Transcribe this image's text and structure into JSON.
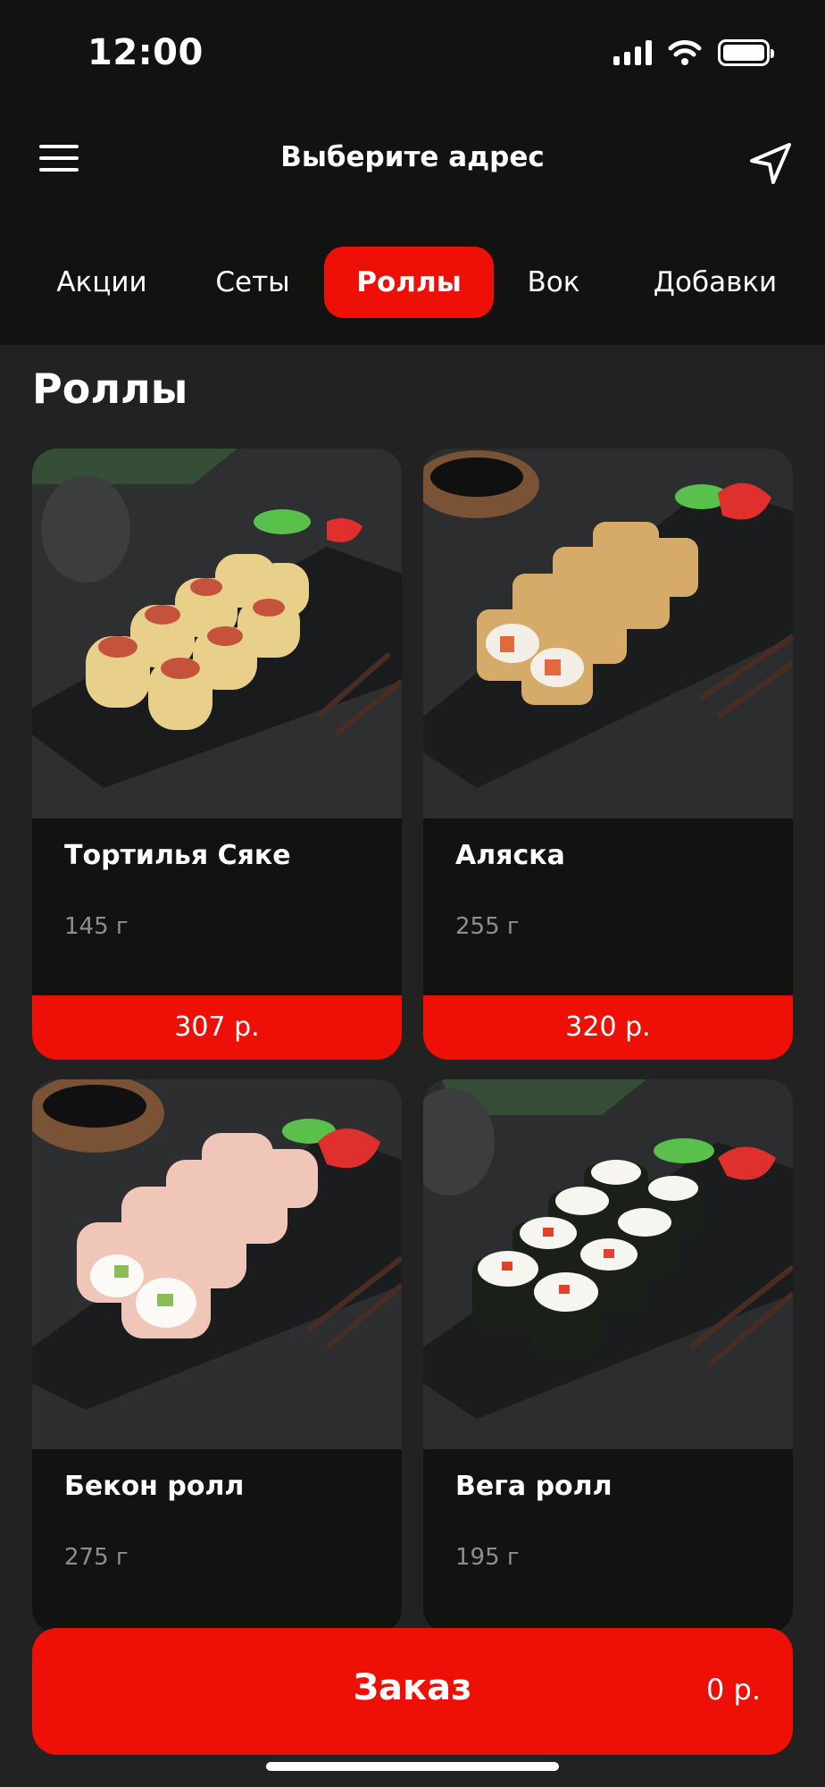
{
  "status_bar": {
    "time": "12:00",
    "icons": [
      "signal-icon",
      "wifi-icon",
      "battery-icon"
    ]
  },
  "header": {
    "menu_icon": "menu-icon",
    "title": "Выберите адрес",
    "location_icon": "navigation-arrow-icon"
  },
  "tabs": [
    {
      "label": "Акции",
      "active": false
    },
    {
      "label": "Сеты",
      "active": false
    },
    {
      "label": "Роллы",
      "active": true
    },
    {
      "label": "Вок",
      "active": false
    },
    {
      "label": "Добавки",
      "active": false
    }
  ],
  "section": {
    "title": "Роллы"
  },
  "products": [
    {
      "name": "Тортилья Сяке",
      "weight": "145 г",
      "price": "307 р."
    },
    {
      "name": "Аляска",
      "weight": "255 г",
      "price": "320 р."
    },
    {
      "name": "Бекон ролл",
      "weight": "275 г",
      "price": ""
    },
    {
      "name": "Вега ролл",
      "weight": "195 г",
      "price": ""
    }
  ],
  "order": {
    "label": "Заказ",
    "total": "0 р."
  },
  "colors": {
    "accent": "#ee1006",
    "header_bg": "#121311",
    "page_bg": "#222222",
    "muted_text": "#8e8e8e"
  }
}
